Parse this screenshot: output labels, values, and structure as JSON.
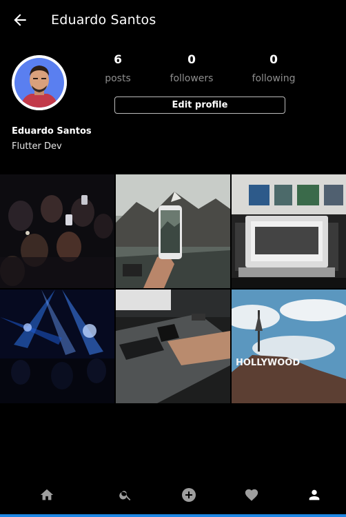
{
  "header": {
    "title": "Eduardo Santos"
  },
  "profile": {
    "name": "Eduardo Santos",
    "bio": "Flutter Dev",
    "stats": [
      {
        "value": "6",
        "label": "posts"
      },
      {
        "value": "0",
        "label": "followers"
      },
      {
        "value": "0",
        "label": "following"
      }
    ],
    "edit_label": "Edit profile",
    "avatar_bg": "#5a7ff0"
  },
  "posts": [
    {
      "subject": "concert crowd with phones"
    },
    {
      "subject": "hand holding phone in front of mountains"
    },
    {
      "subject": "laptop on desk with photo grid"
    },
    {
      "subject": "concert stage lights"
    },
    {
      "subject": "hand on phone on cutting mat desk"
    },
    {
      "subject": "hollywood sign hill and sky",
      "sign_text": "HOLLYWOOD"
    }
  ],
  "bottom_nav": [
    "home-icon",
    "search-icon",
    "add-icon",
    "heart-icon",
    "profile-icon"
  ],
  "colors": {
    "background": "#000000",
    "muted": "#8e8e8e",
    "accent_line": "#1e88e5"
  }
}
